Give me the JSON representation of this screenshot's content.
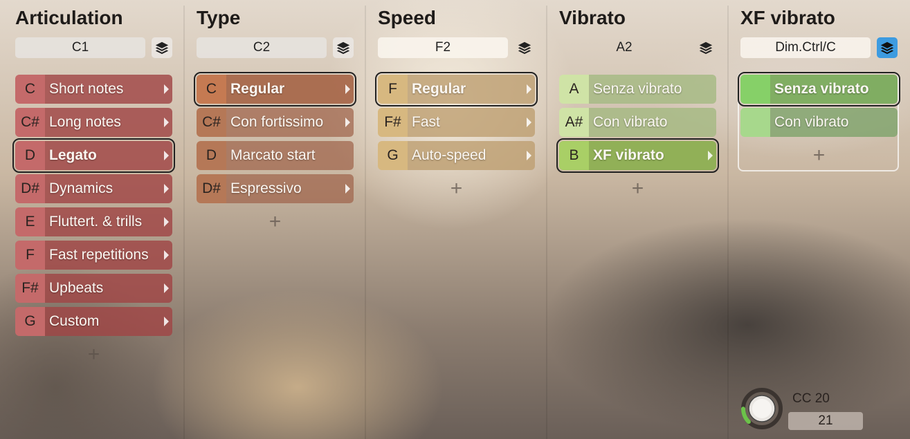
{
  "columns": [
    {
      "title": "Articulation",
      "key": "C1",
      "rows": [
        {
          "note": "C",
          "label": "Short notes"
        },
        {
          "note": "C#",
          "label": "Long notes"
        },
        {
          "note": "D",
          "label": "Legato"
        },
        {
          "note": "D#",
          "label": "Dynamics"
        },
        {
          "note": "E",
          "label": "Fluttert. & trills"
        },
        {
          "note": "F",
          "label": "Fast repetitions"
        },
        {
          "note": "F#",
          "label": "Upbeats"
        },
        {
          "note": "G",
          "label": "Custom"
        }
      ],
      "add_label": "+"
    },
    {
      "title": "Type",
      "key": "C2",
      "rows": [
        {
          "note": "C",
          "label": "Regular"
        },
        {
          "note": "C#",
          "label": "Con fortissimo"
        },
        {
          "note": "D",
          "label": "Marcato start"
        },
        {
          "note": "D#",
          "label": "Espressivo"
        }
      ],
      "add_label": "+"
    },
    {
      "title": "Speed",
      "key": "F2",
      "rows": [
        {
          "note": "F",
          "label": "Regular"
        },
        {
          "note": "F#",
          "label": "Fast"
        },
        {
          "note": "G",
          "label": "Auto-speed"
        }
      ],
      "add_label": "+"
    },
    {
      "title": "Vibrato",
      "key": "A2",
      "rows": [
        {
          "note": "A",
          "label": "Senza vibrato"
        },
        {
          "note": "A#",
          "label": "Con vibrato"
        },
        {
          "note": "B",
          "label": "XF vibrato"
        }
      ],
      "add_label": "+"
    },
    {
      "title": "XF vibrato",
      "key": "Dim.Ctrl/C",
      "rows": [
        {
          "note": "",
          "label": "Senza vibrato"
        },
        {
          "note": "",
          "label": "Con vibrato"
        }
      ],
      "add_label": "+"
    }
  ],
  "controller": {
    "label": "CC 20",
    "value": "21",
    "level_fraction": 0.165
  },
  "colors": {
    "selected_outline": "#222222",
    "layers_active": "#3d9be0",
    "knob_arc": "#6cc24a"
  },
  "icons": {
    "layers": "layers-icon",
    "arrow": "chevron-right-icon",
    "add": "plus-icon"
  }
}
